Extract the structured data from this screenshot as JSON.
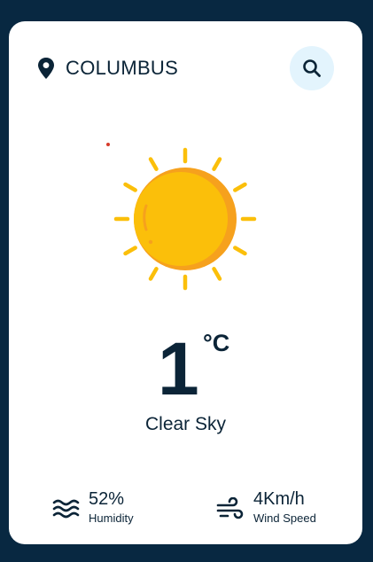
{
  "location": {
    "city": "COLUMBUS",
    "icon": "map-pin-icon"
  },
  "search": {
    "icon": "search-icon"
  },
  "weather": {
    "icon": "sun-icon",
    "temperature": "1",
    "unit": "°C",
    "condition": "Clear Sky"
  },
  "stats": {
    "humidity": {
      "value": "52%",
      "label": "Humidity",
      "icon": "humidity-waves-icon"
    },
    "wind": {
      "value": "4Km/h",
      "label": "Wind Speed",
      "icon": "wind-icon"
    }
  },
  "colors": {
    "background": "#082841",
    "card": "#ffffff",
    "text": "#0b2437",
    "search_bg": "#e3f4fd",
    "sun": "#fbbf0a",
    "sun_shade": "#f6a11d"
  }
}
